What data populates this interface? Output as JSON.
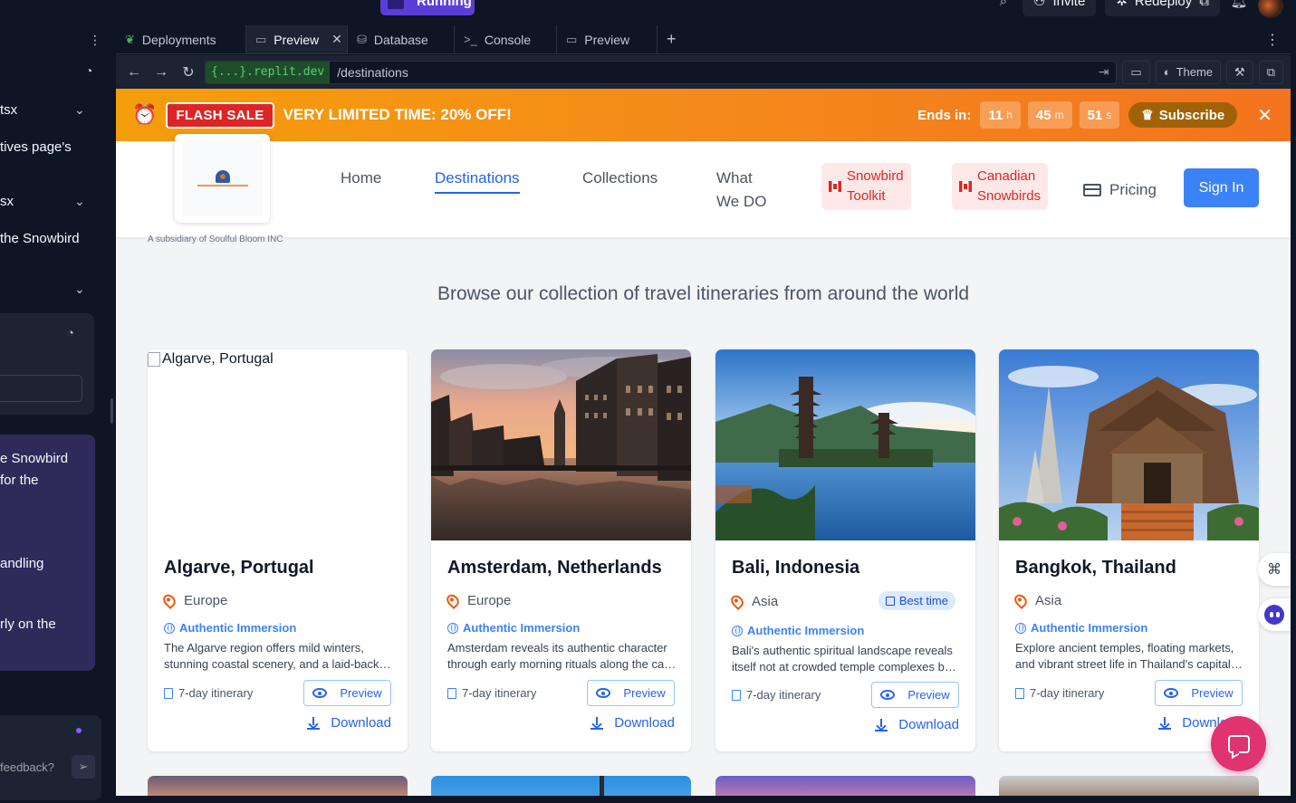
{
  "topbar": {
    "running_label": "Running",
    "invite_label": "Invite",
    "redeploy_label": "Redeploy"
  },
  "left_panel": {
    "rows": [
      {
        "text": "tsx"
      },
      {
        "text": "tives page's"
      },
      {
        "text": "sx"
      },
      {
        "text": "the Snowbird"
      },
      {
        "text": "e Snowbird"
      },
      {
        "text": "for the"
      },
      {
        "text": "andling"
      },
      {
        "text": "rly on the"
      }
    ],
    "feedback_placeholder": "feedback?"
  },
  "tabs": [
    {
      "label": "Deployments",
      "icon": "deployments-icon"
    },
    {
      "label": "Preview",
      "icon": "monitor-icon",
      "active": true
    },
    {
      "label": "Database",
      "icon": "database-icon"
    },
    {
      "label": "Console",
      "icon": "terminal-icon"
    },
    {
      "label": "Preview",
      "icon": "monitor-icon"
    }
  ],
  "urlbar": {
    "domain": "{...}.replit.dev",
    "path": "/destinations",
    "theme_label": "Theme"
  },
  "flash_sale": {
    "badge": "FLASH SALE",
    "text": "VERY LIMITED TIME:  20% OFF!",
    "ends_label": "Ends in:",
    "hours": "11",
    "hours_unit": "h",
    "minutes": "45",
    "minutes_unit": "m",
    "seconds": "51",
    "seconds_unit": "s",
    "subscribe_label": "Subscribe"
  },
  "header": {
    "subsidiary": "A subsidiary of Soulful Bloom INC",
    "nav": {
      "home": "Home",
      "destinations": "Destinations",
      "collections": "Collections",
      "what_line1": "What",
      "what_line2": "We DO",
      "toolkit_line1": "Snowbird",
      "toolkit_line2": "Toolkit",
      "canadian_line1": "Canadian",
      "canadian_line2": "Snowbirds",
      "pricing": "Pricing",
      "signin": "Sign In"
    }
  },
  "page": {
    "subtitle": "Browse our collection of travel itineraries from around the world"
  },
  "destinations": [
    {
      "title": "Algarve, Portugal",
      "image_alt": "Algarve, Portugal",
      "region": "Europe",
      "tag": "Authentic Immersion",
      "desc_line1": "The Algarve region offers mild winters,",
      "desc_line2": "stunning coastal scenery, and a laid-back lifestyle",
      "itinerary": "7-day itinerary",
      "preview_label": "Preview",
      "download_label": "Download"
    },
    {
      "title": "Amsterdam, Netherlands",
      "region": "Europe",
      "tag": "Authentic Immersion",
      "desc_line1": "Amsterdam reveals its authentic character",
      "desc_line2": "through early morning rituals along the canals",
      "itinerary": "7-day itinerary",
      "preview_label": "Preview",
      "download_label": "Download"
    },
    {
      "title": "Bali, Indonesia",
      "region": "Asia",
      "best_time": "Best time",
      "tag": "Authentic Immersion",
      "desc_line1": "Bali's authentic spiritual landscape reveals",
      "desc_line2": "itself not at crowded temple complexes but in villages",
      "itinerary": "7-day itinerary",
      "preview_label": "Preview",
      "download_label": "Download"
    },
    {
      "title": "Bangkok, Thailand",
      "region": "Asia",
      "tag": "Authentic Immersion",
      "desc_line1": "Explore ancient temples, floating markets,",
      "desc_line2": "and vibrant street life in Thailand's capital city",
      "itinerary": "7-day itinerary",
      "preview_label": "Preview",
      "download_label": "Download"
    }
  ],
  "colors": {
    "ide_bg": "#0e1525",
    "flash_orange": "#f58a1a",
    "brand_blue": "#3b82f6",
    "chat_pink": "#e0336f"
  }
}
